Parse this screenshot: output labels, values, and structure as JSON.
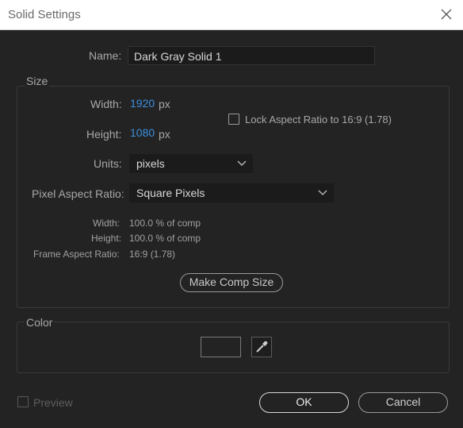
{
  "window": {
    "title": "Solid Settings"
  },
  "name": {
    "label": "Name:",
    "value": "Dark Gray Solid 1"
  },
  "size": {
    "group_label": "Size",
    "width_label": "Width:",
    "width_value": "1920",
    "width_unit": "px",
    "height_label": "Height:",
    "height_value": "1080",
    "height_unit": "px",
    "lock_aspect_label": "Lock Aspect Ratio to 16:9 (1.78)",
    "lock_aspect_checked": false,
    "units_label": "Units:",
    "units_value": "pixels",
    "par_label": "Pixel Aspect Ratio:",
    "par_value": "Square Pixels",
    "info_width_label": "Width:",
    "info_width_value": "100.0 % of comp",
    "info_height_label": "Height:",
    "info_height_value": "100.0 % of comp",
    "info_far_label": "Frame Aspect Ratio:",
    "info_far_value": "16:9 (1.78)",
    "make_comp_size_label": "Make Comp Size"
  },
  "color": {
    "group_label": "Color",
    "swatch_color": "#232323"
  },
  "footer": {
    "preview_label": "Preview",
    "ok_label": "OK",
    "cancel_label": "Cancel"
  },
  "icons": {
    "close": "close-icon",
    "dropdown": "chevron-down-icon",
    "eyedropper": "eyedropper-icon"
  }
}
